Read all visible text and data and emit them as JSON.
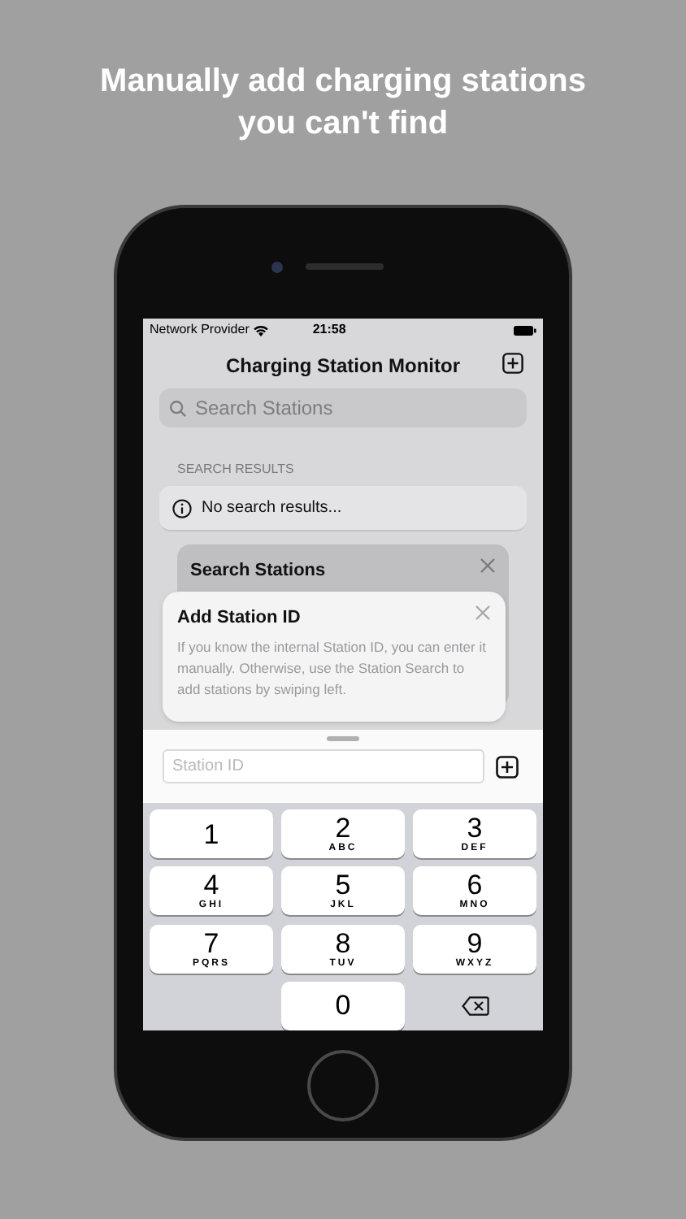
{
  "headline": "Manually add charging stations\nyou can't find",
  "status_bar": {
    "carrier": "Network Provider",
    "time": "21:58"
  },
  "nav": {
    "title": "Charging Station Monitor"
  },
  "search": {
    "placeholder": "Search Stations"
  },
  "section_header": "SEARCH RESULTS",
  "results": [
    {
      "text": "No search results..."
    }
  ],
  "search_card": {
    "title": "Search Stations"
  },
  "popover": {
    "title": "Add Station ID",
    "body": "If you know the internal Station ID, you can enter it manually. Otherwise, use the Station Search to add stations by swiping left."
  },
  "station_field": {
    "placeholder": "Station ID"
  },
  "keypad": [
    {
      "kind": "digit",
      "digit": "1"
    },
    {
      "kind": "digit",
      "digit": "2",
      "letters": "ABC"
    },
    {
      "kind": "digit",
      "digit": "3",
      "letters": "DEF"
    },
    {
      "kind": "digit",
      "digit": "4",
      "letters": "GHI"
    },
    {
      "kind": "digit",
      "digit": "5",
      "letters": "JKL"
    },
    {
      "kind": "digit",
      "digit": "6",
      "letters": "MNO"
    },
    {
      "kind": "digit",
      "digit": "7",
      "letters": "PQRS"
    },
    {
      "kind": "digit",
      "digit": "8",
      "letters": "TUV"
    },
    {
      "kind": "digit",
      "digit": "9",
      "letters": "WXYZ"
    },
    {
      "kind": "blank"
    },
    {
      "kind": "digit",
      "digit": "0"
    },
    {
      "kind": "delete"
    }
  ]
}
